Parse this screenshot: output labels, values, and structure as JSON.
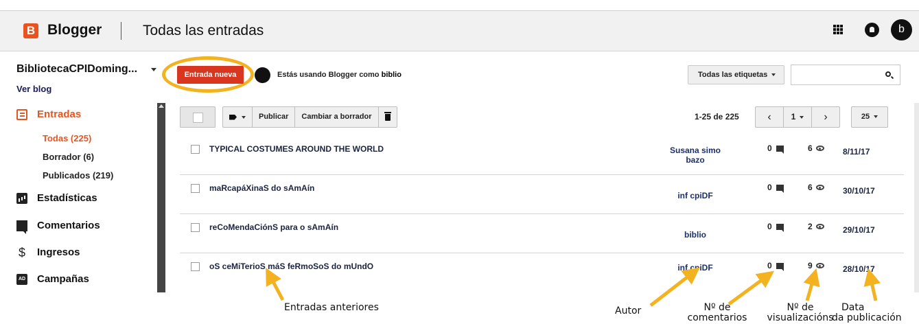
{
  "header": {
    "logo_letter": "B",
    "brand": "Blogger",
    "title": "Todas las entradas",
    "avatar_letter": "b"
  },
  "sidebar": {
    "blog_name": "BibliotecaCPIDoming...",
    "view_blog": "Ver blog",
    "posts_label": "Entradas",
    "sub_items": [
      "Todas (225)",
      "Borrador (6)",
      "Publicados (219)"
    ],
    "stats_label": "Estadísticas",
    "comments_label": "Comentarios",
    "earnings_label": "Ingresos",
    "campaigns_label": "Campañas"
  },
  "actions": {
    "new_post": "Entrada nueva",
    "using_prefix": "Estás usando Blogger como ",
    "using_user": "biblio",
    "labels_filter": "Todas las etiquetas",
    "search_placeholder": ""
  },
  "toolbar": {
    "publish": "Publicar",
    "revert": "Cambiar a borrador",
    "range": "1-25 de 225",
    "page": "1",
    "per_page": "25"
  },
  "posts": [
    {
      "title": "TYPICAL COSTUMES AROUND THE WORLD",
      "author": "Susana simo bazo",
      "comments": "0",
      "views": "6",
      "date": "8/11/17"
    },
    {
      "title": "maRcapáXinaS do sAmAín",
      "author": "inf cpiDF",
      "comments": "0",
      "views": "6",
      "date": "30/10/17"
    },
    {
      "title": "reCoMendaCiónS para o sAmAín",
      "author": "biblio",
      "comments": "0",
      "views": "2",
      "date": "29/10/17"
    },
    {
      "title": "oS ceMiTerioS máS feRmoSoS do mUndO",
      "author": "inf cpiDF",
      "comments": "0",
      "views": "9",
      "date": "28/10/17"
    }
  ],
  "annotations": {
    "previous_posts": "Entradas anteriores",
    "author": "Autor",
    "comments_a": "Nº de",
    "comments_b": "comentarios",
    "views_a": "Nº de",
    "views_b": "visualizacións",
    "date_a": "Data",
    "date_b": "da publicación"
  },
  "colors": {
    "brand_orange": "#e8541f",
    "new_post_red": "#d9361f",
    "highlight_ring": "#f3b220"
  }
}
